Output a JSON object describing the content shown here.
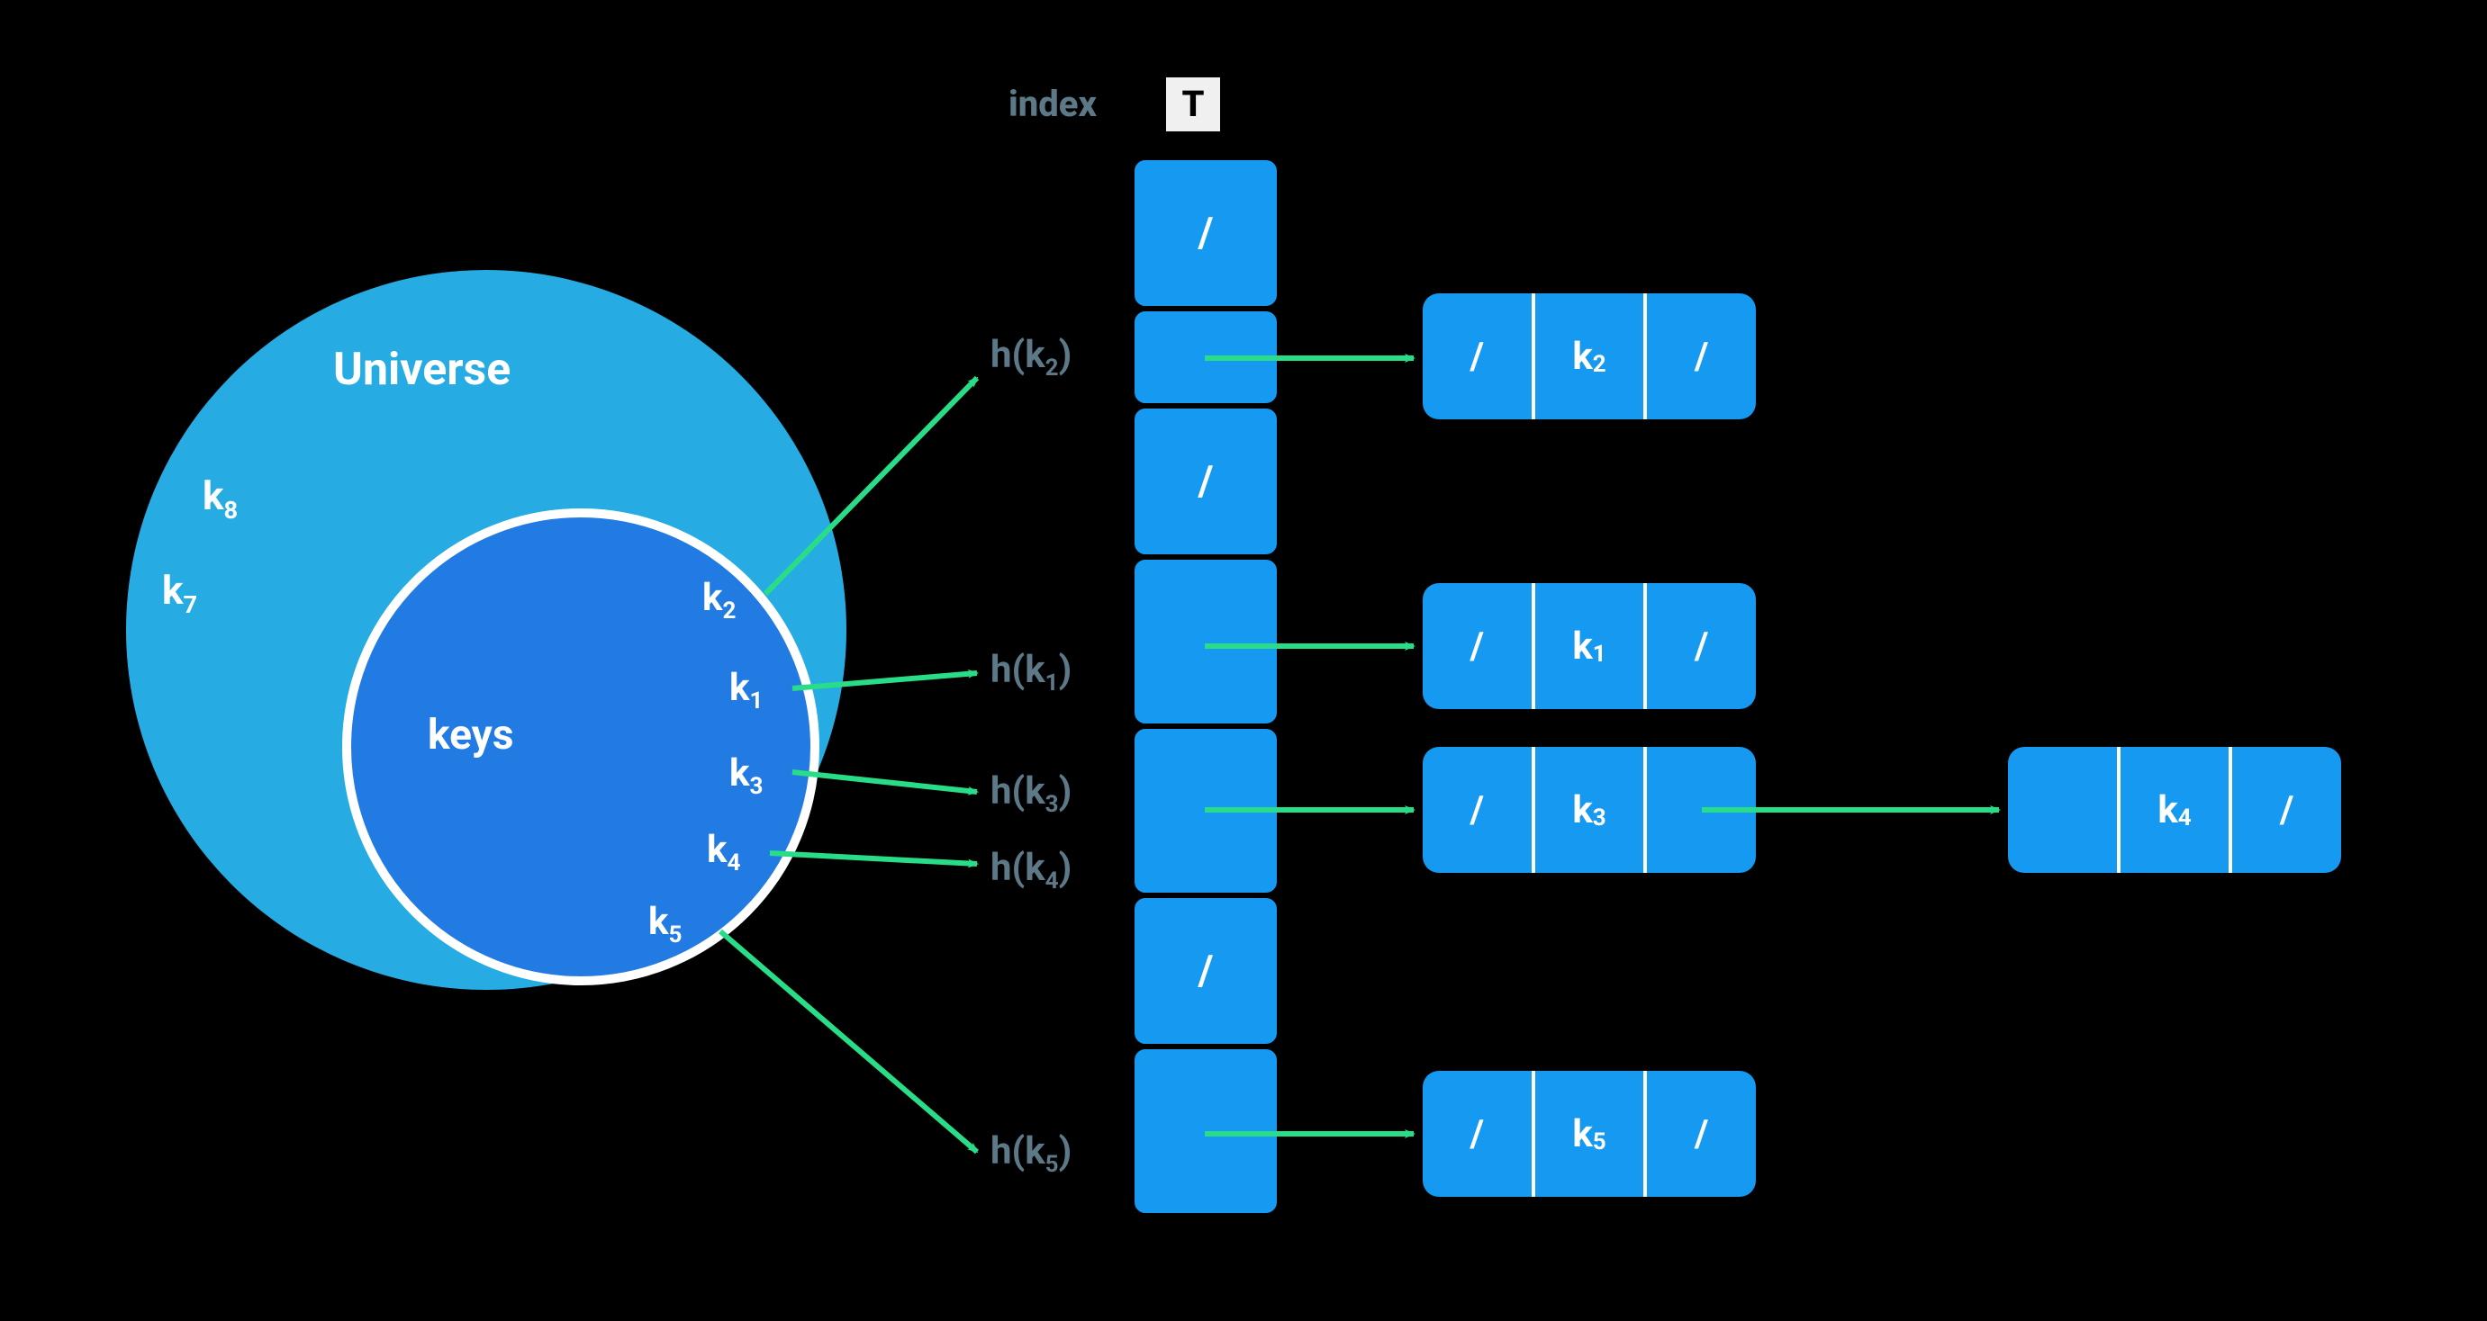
{
  "universe": {
    "label": "Universe",
    "outside_keys": [
      "k₈",
      "k₇"
    ]
  },
  "keys": {
    "label": "keys",
    "inside_keys": [
      "k₂",
      "k₁",
      "k₃",
      "k₄",
      "k₅"
    ]
  },
  "header": {
    "index_label": "index",
    "table_label": "T"
  },
  "hash_labels": {
    "h_k2": "h(k₂)",
    "h_k1": "h(k₁)",
    "h_k3": "h(k₃)",
    "h_k4": "h(k₄)",
    "h_k5": "h(k₅)"
  },
  "table_slots": {
    "s0": "/",
    "s1": "",
    "s2": "/",
    "s3": "",
    "s4": "",
    "s5": "/",
    "s6": ""
  },
  "nodes": {
    "n_k2": {
      "prev": "/",
      "key": "k₂",
      "next": "/"
    },
    "n_k1": {
      "prev": "/",
      "key": "k₁",
      "next": "/"
    },
    "n_k3": {
      "prev": "/",
      "key": "k₃",
      "next": ""
    },
    "n_k4": {
      "prev": "",
      "key": "k₄",
      "next": "/"
    },
    "n_k5": {
      "prev": "/",
      "key": "k₅",
      "next": "/"
    }
  },
  "colors": {
    "universe": "#26ace2",
    "keys": "#227be3",
    "slot": "#169af1",
    "arrow": "#29dd88",
    "dim": "#5d7887"
  }
}
